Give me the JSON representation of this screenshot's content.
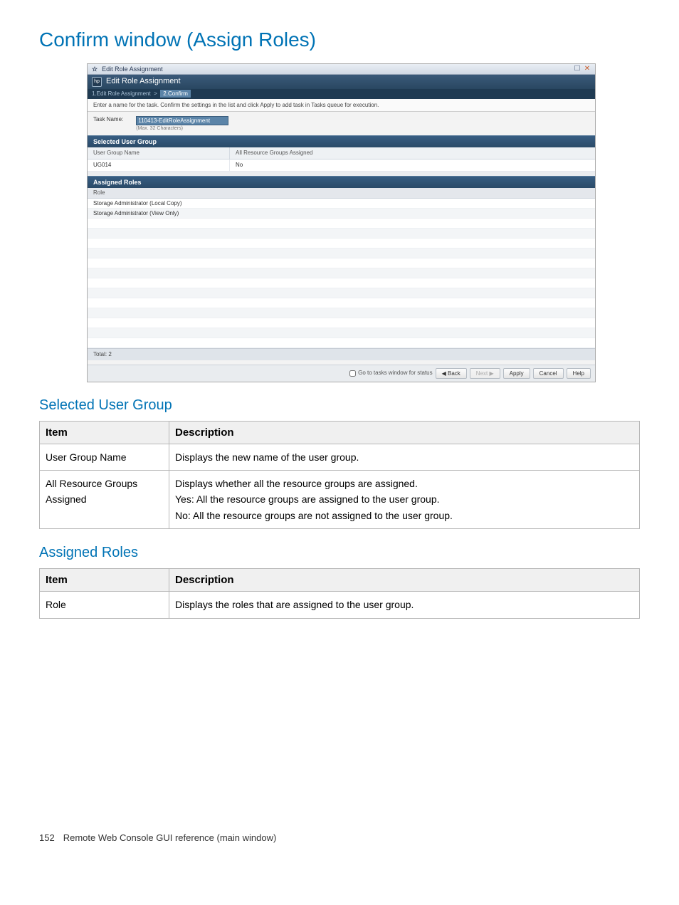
{
  "page_title": "Confirm window (Assign Roles)",
  "sections": {
    "selected_user_group_title": "Selected User Group",
    "assigned_roles_title": "Assigned Roles"
  },
  "shot": {
    "outer_title": "Edit Role Assignment",
    "inner_title": "Edit Role Assignment",
    "breadcrumb": {
      "step1": "1.Edit Role Assignment",
      "sep": ">",
      "step2": "2.Confirm"
    },
    "instruction": "Enter a name for the task. Confirm the settings in the list and click Apply to add task in Tasks queue for execution.",
    "task_name_label": "Task Name:",
    "task_name_value": "110413-EditRoleAssignment",
    "task_name_hint": "(Max. 32 Characters)",
    "selected_user_group_band": "Selected User Group",
    "sug_headers": {
      "c1": "User Group Name",
      "c2": "All Resource Groups Assigned"
    },
    "sug_row": {
      "c1": "UG014",
      "c2": "No"
    },
    "assigned_roles_band": "Assigned Roles",
    "role_header": "Role",
    "roles": [
      "Storage Administrator (Local Copy)",
      "Storage Administrator (View Only)"
    ],
    "total_label": "Total: 2",
    "footer": {
      "checkbox_label": "Go to tasks window for status",
      "back": "Back",
      "next": "Next",
      "apply": "Apply",
      "cancel": "Cancel",
      "help": "Help"
    }
  },
  "tables": {
    "selected_user_group": {
      "headers": {
        "item": "Item",
        "desc": "Description"
      },
      "rows": [
        {
          "item": "User Group Name",
          "desc": [
            "Displays the new name of the user group."
          ]
        },
        {
          "item": "All Resource Groups Assigned",
          "desc": [
            "Displays whether all the resource groups are assigned.",
            "Yes: All the resource groups are assigned to the user group.",
            "No: All the resource groups are not assigned to the user group."
          ]
        }
      ]
    },
    "assigned_roles": {
      "headers": {
        "item": "Item",
        "desc": "Description"
      },
      "rows": [
        {
          "item": "Role",
          "desc": [
            "Displays the roles that are assigned to the user group."
          ]
        }
      ]
    }
  },
  "footer": {
    "page_number": "152",
    "book_section": "Remote Web Console GUI reference (main window)"
  }
}
